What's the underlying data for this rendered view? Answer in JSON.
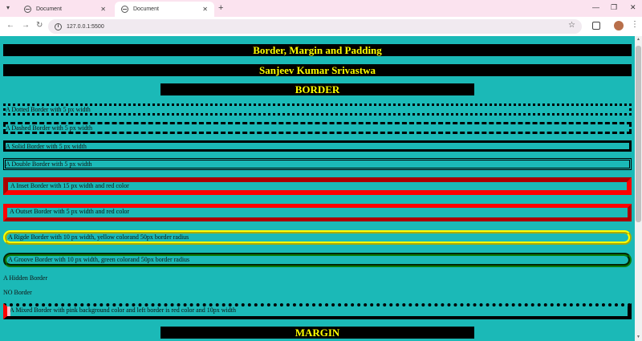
{
  "browser": {
    "tabs": [
      {
        "label": "Document"
      },
      {
        "label": "Document"
      }
    ],
    "address": "127.0.0.1:5500"
  },
  "page": {
    "title": "Border, Margin and Padding",
    "author": "Sanjeev Kumar Srivastwa",
    "section_border": "BORDER",
    "section_margin": "MARGIN",
    "examples": {
      "dotted": "A Dotted Border with 5 px width",
      "dashed": "A Dashed Border with 5 px width",
      "solid": "A Solid Border with 5 px width",
      "double": "A Double Border with 5 px width",
      "inset": "A Inset Border with 15 px width and red color",
      "outset": "A Outset Border with 5 px width and red color",
      "ridge": "A Rigde Border with 10 px width, yellow colorand 50px border radius",
      "groove": "A Groove Border with 10 px width, green colorand 50px border radius",
      "hidden": "A Hidden Border",
      "none": "NO Border",
      "mixed": "A Mixed Border with pink background color and left border is red color and 10px width"
    }
  },
  "colors": {
    "page_bg": "#1bb9b7",
    "heading_bg": "#000000",
    "heading_text": "#ffff00",
    "red_border": "#ff0000",
    "green_border": "#0a7a0a"
  }
}
